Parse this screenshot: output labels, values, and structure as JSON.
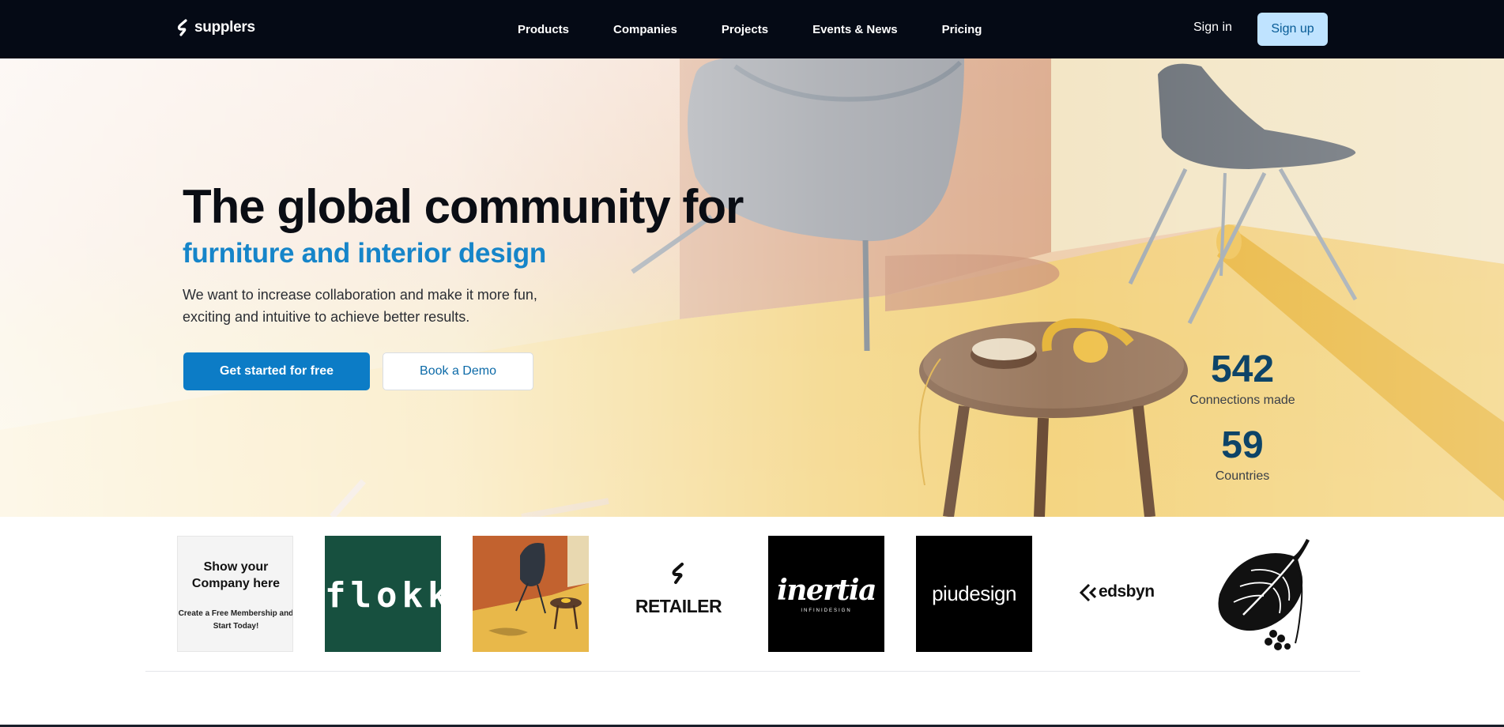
{
  "brand": {
    "name": "supplers"
  },
  "nav": {
    "links": [
      "Products",
      "Companies",
      "Projects",
      "Events & News",
      "Pricing"
    ],
    "signin": "Sign in",
    "signup": "Sign up"
  },
  "hero": {
    "title": "The global community for",
    "subtitle": "furniture and interior design",
    "description": "We want to increase collaboration and make it more fun, exciting and intuitive to achieve better results.",
    "cta_primary": "Get started for free",
    "cta_secondary": "Book a Demo",
    "stats": [
      {
        "value": "542",
        "label": "Connections made"
      },
      {
        "value": "59",
        "label": "Countries"
      }
    ]
  },
  "partners": {
    "promo_title": "Show your Company here",
    "promo_sub": "Create a Free Membership and Start Today!",
    "logos": {
      "flokk": "flokk",
      "retailer": "RETAILER",
      "inertia": "inertia",
      "inertia_small": "INFINIDESIGN",
      "piudesign": "piudesign",
      "edsbyn": "edsbyn"
    }
  },
  "colors": {
    "nav_bg": "#050a15",
    "accent": "#1685c9",
    "primary_button": "#0c7cc6",
    "signup_bg": "#bfe3ff",
    "stat_color": "#0d4468"
  }
}
